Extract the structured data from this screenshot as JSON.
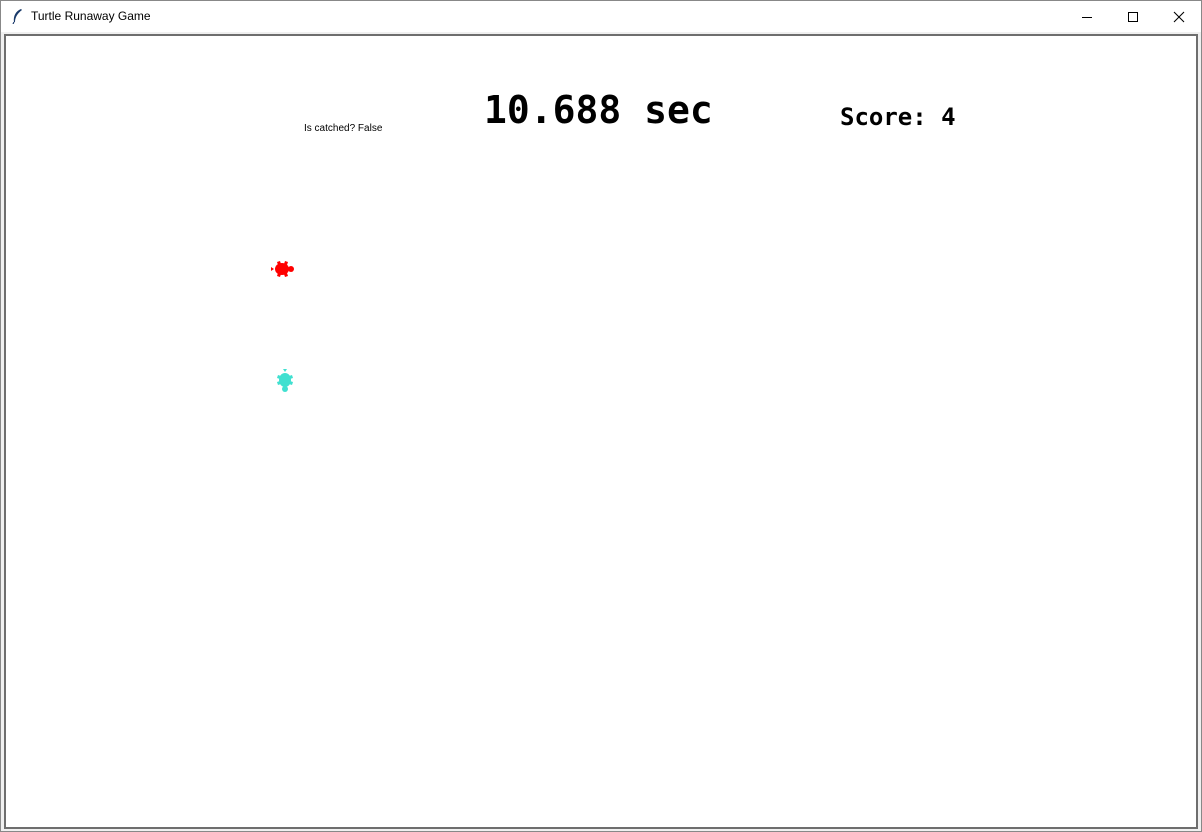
{
  "window": {
    "title": "Turtle Runaway Game"
  },
  "hud": {
    "caught_status": "Is catched? False",
    "timer": "10.688 sec",
    "score": "Score: 4"
  },
  "turtles": {
    "chaser": {
      "color": "#ff0000",
      "shape": "turtle"
    },
    "runner": {
      "color": "#40e0d0",
      "shape": "turtle"
    }
  },
  "colors": {
    "canvas_background": "#ffffff",
    "text": "#000000"
  }
}
